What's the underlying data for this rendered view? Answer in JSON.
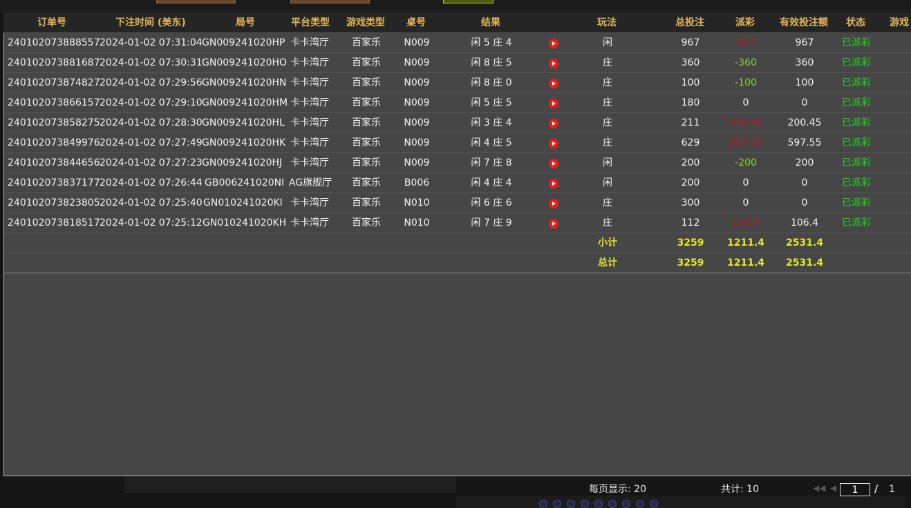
{
  "columns": {
    "order_no": "订单号",
    "bet_time": "下注时间 (美东)",
    "round_no": "局号",
    "platform": "平台类型",
    "game_type": "游戏类型",
    "table_no": "桌号",
    "result": "结果",
    "play": "玩法",
    "total_bet": "总投注",
    "payout": "派彩",
    "valid_bet": "有效投注额",
    "status": "状态",
    "game": "游戏"
  },
  "rows": [
    {
      "order_no": "240102073888557",
      "bet_time": "2024-01-02 07:31:04",
      "round_no": "GN009241020HP",
      "platform": "卡卡湾厅",
      "game_type": "百家乐",
      "table_no": "N009",
      "result": "闲 5 庄 4",
      "play": "闲",
      "total_bet": "967",
      "payout": "967",
      "payout_style": "red",
      "valid_bet": "967",
      "status": "已派彩"
    },
    {
      "order_no": "240102073881687",
      "bet_time": "2024-01-02 07:30:31",
      "round_no": "GN009241020HO",
      "platform": "卡卡湾厅",
      "game_type": "百家乐",
      "table_no": "N009",
      "result": "闲 8 庄 5",
      "play": "庄",
      "total_bet": "360",
      "payout": "-360",
      "payout_style": "neg",
      "valid_bet": "360",
      "status": "已派彩"
    },
    {
      "order_no": "240102073874827",
      "bet_time": "2024-01-02 07:29:56",
      "round_no": "GN009241020HN",
      "platform": "卡卡湾厅",
      "game_type": "百家乐",
      "table_no": "N009",
      "result": "闲 8 庄 0",
      "play": "庄",
      "total_bet": "100",
      "payout": "-100",
      "payout_style": "neg",
      "valid_bet": "100",
      "status": "已派彩"
    },
    {
      "order_no": "240102073866157",
      "bet_time": "2024-01-02 07:29:10",
      "round_no": "GN009241020HM",
      "platform": "卡卡湾厅",
      "game_type": "百家乐",
      "table_no": "N009",
      "result": "闲 5 庄 5",
      "play": "庄",
      "total_bet": "180",
      "payout": "0",
      "payout_style": "plain",
      "valid_bet": "0",
      "status": "已派彩"
    },
    {
      "order_no": "240102073858275",
      "bet_time": "2024-01-02 07:28:30",
      "round_no": "GN009241020HL",
      "platform": "卡卡湾厅",
      "game_type": "百家乐",
      "table_no": "N009",
      "result": "闲 3 庄 4",
      "play": "庄",
      "total_bet": "211",
      "payout": "200.45",
      "payout_style": "red",
      "valid_bet": "200.45",
      "status": "已派彩"
    },
    {
      "order_no": "240102073849976",
      "bet_time": "2024-01-02 07:27:49",
      "round_no": "GN009241020HK",
      "platform": "卡卡湾厅",
      "game_type": "百家乐",
      "table_no": "N009",
      "result": "闲 4 庄 5",
      "play": "庄",
      "total_bet": "629",
      "payout": "597.55",
      "payout_style": "red",
      "valid_bet": "597.55",
      "status": "已派彩"
    },
    {
      "order_no": "240102073844656",
      "bet_time": "2024-01-02 07:27:23",
      "round_no": "GN009241020HJ",
      "platform": "卡卡湾厅",
      "game_type": "百家乐",
      "table_no": "N009",
      "result": "闲 7 庄 8",
      "play": "闲",
      "total_bet": "200",
      "payout": "-200",
      "payout_style": "neg",
      "valid_bet": "200",
      "status": "已派彩"
    },
    {
      "order_no": "240102073837177",
      "bet_time": "2024-01-02 07:26:44",
      "round_no": "GB006241020NI",
      "platform": "AG旗舰厅",
      "game_type": "百家乐",
      "table_no": "B006",
      "result": "闲 4 庄 4",
      "play": "闲",
      "total_bet": "200",
      "payout": "0",
      "payout_style": "plain",
      "valid_bet": "0",
      "status": "已派彩"
    },
    {
      "order_no": "240102073823805",
      "bet_time": "2024-01-02 07:25:40",
      "round_no": "GN010241020KI",
      "platform": "卡卡湾厅",
      "game_type": "百家乐",
      "table_no": "N010",
      "result": "闲 6 庄 6",
      "play": "庄",
      "total_bet": "300",
      "payout": "0",
      "payout_style": "plain",
      "valid_bet": "0",
      "status": "已派彩"
    },
    {
      "order_no": "240102073818517",
      "bet_time": "2024-01-02 07:25:12",
      "round_no": "GN010241020KH",
      "platform": "卡卡湾厅",
      "game_type": "百家乐",
      "table_no": "N010",
      "result": "闲 7 庄 9",
      "play": "庄",
      "total_bet": "112",
      "payout": "106.4",
      "payout_style": "red",
      "valid_bet": "106.4",
      "status": "已派彩"
    }
  ],
  "subtotal": {
    "label": "小计",
    "total_bet": "3259",
    "payout": "1211.4",
    "valid_bet": "2531.4"
  },
  "grand_total": {
    "label": "总计",
    "total_bet": "3259",
    "payout": "1211.4",
    "valid_bet": "2531.4"
  },
  "footer": {
    "page_size": "每页显示: 20",
    "total_count": "共计: 10",
    "current_page": "1",
    "page_sep": "/",
    "total_pages": "1",
    "prev_icon": "prev-page-icon",
    "first_icon": "first-page-icon"
  },
  "colors": {
    "header_text": "#e3b65a",
    "status_green": "#24d024",
    "payout_red": "#b0182a",
    "payout_negative": "#8ed234",
    "total_yellow": "#e6e62a",
    "play_button": "#e81d1d"
  }
}
